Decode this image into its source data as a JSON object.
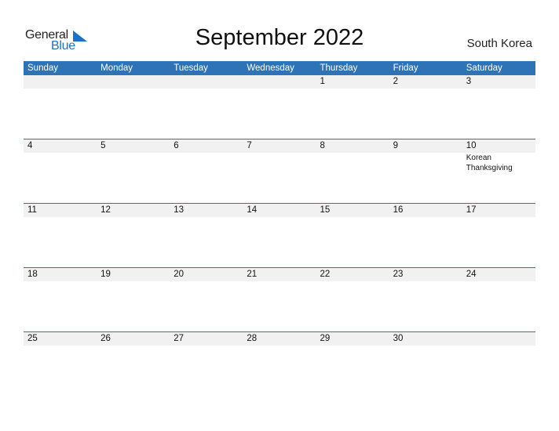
{
  "logo": {
    "text_general": "General",
    "text_blue": "Blue"
  },
  "title": "September 2022",
  "country": "South Korea",
  "colors": {
    "accent": "#2e73b5",
    "band": "#f1f1f1"
  },
  "weekdays": [
    "Sunday",
    "Monday",
    "Tuesday",
    "Wednesday",
    "Thursday",
    "Friday",
    "Saturday"
  ],
  "weeks": [
    [
      {
        "d": ""
      },
      {
        "d": ""
      },
      {
        "d": ""
      },
      {
        "d": ""
      },
      {
        "d": "1"
      },
      {
        "d": "2"
      },
      {
        "d": "3"
      }
    ],
    [
      {
        "d": "4"
      },
      {
        "d": "5"
      },
      {
        "d": "6"
      },
      {
        "d": "7"
      },
      {
        "d": "8"
      },
      {
        "d": "9"
      },
      {
        "d": "10",
        "events": [
          "Korean",
          "Thanksgiving"
        ]
      }
    ],
    [
      {
        "d": "11"
      },
      {
        "d": "12"
      },
      {
        "d": "13"
      },
      {
        "d": "14"
      },
      {
        "d": "15"
      },
      {
        "d": "16"
      },
      {
        "d": "17"
      }
    ],
    [
      {
        "d": "18"
      },
      {
        "d": "19"
      },
      {
        "d": "20"
      },
      {
        "d": "21"
      },
      {
        "d": "22"
      },
      {
        "d": "23"
      },
      {
        "d": "24"
      }
    ],
    [
      {
        "d": "25"
      },
      {
        "d": "26"
      },
      {
        "d": "27"
      },
      {
        "d": "28"
      },
      {
        "d": "29"
      },
      {
        "d": "30"
      },
      {
        "d": ""
      }
    ]
  ]
}
